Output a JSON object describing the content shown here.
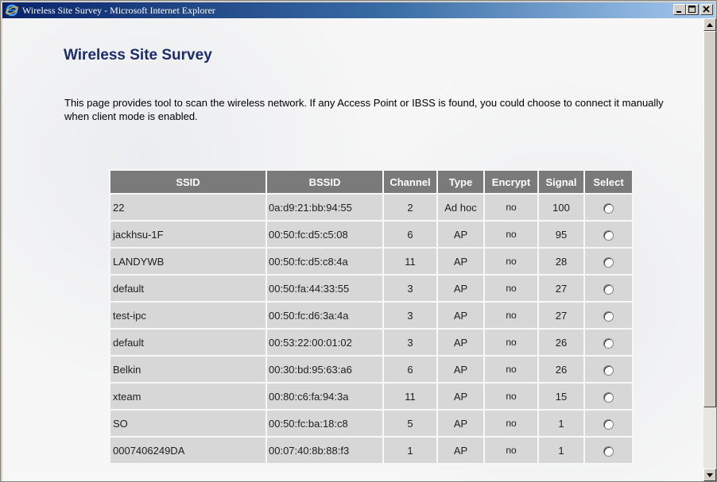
{
  "window": {
    "title": "Wireless Site Survey - Microsoft Internet Explorer",
    "minimize_glyph": "_",
    "maximize_glyph": "□",
    "close_glyph": "✕"
  },
  "page": {
    "title": "Wireless Site Survey",
    "description": "This page provides tool to scan the wireless network. If any Access Point or IBSS is found, you could choose to connect it manually when client mode is enabled."
  },
  "table": {
    "headers": {
      "ssid": "SSID",
      "bssid": "BSSID",
      "channel": "Channel",
      "type": "Type",
      "encrypt": "Encrypt",
      "signal": "Signal",
      "select": "Select"
    },
    "rows": [
      {
        "ssid": "22",
        "bssid": "0a:d9:21:bb:94:55",
        "channel": "2",
        "type": "Ad hoc",
        "encrypt": "no",
        "signal": "100"
      },
      {
        "ssid": "jackhsu-1F",
        "bssid": "00:50:fc:d5:c5:08",
        "channel": "6",
        "type": "AP",
        "encrypt": "no",
        "signal": "95"
      },
      {
        "ssid": "LANDYWB",
        "bssid": "00:50:fc:d5:c8:4a",
        "channel": "11",
        "type": "AP",
        "encrypt": "no",
        "signal": "28"
      },
      {
        "ssid": "default",
        "bssid": "00:50:fa:44:33:55",
        "channel": "3",
        "type": "AP",
        "encrypt": "no",
        "signal": "27"
      },
      {
        "ssid": "test-ipc",
        "bssid": "00:50:fc:d6:3a:4a",
        "channel": "3",
        "type": "AP",
        "encrypt": "no",
        "signal": "27"
      },
      {
        "ssid": "default",
        "bssid": "00:53:22:00:01:02",
        "channel": "3",
        "type": "AP",
        "encrypt": "no",
        "signal": "26"
      },
      {
        "ssid": "Belkin",
        "bssid": "00:30:bd:95:63:a6",
        "channel": "6",
        "type": "AP",
        "encrypt": "no",
        "signal": "26"
      },
      {
        "ssid": "xteam",
        "bssid": "00:80:c6:fa:94:3a",
        "channel": "11",
        "type": "AP",
        "encrypt": "no",
        "signal": "15"
      },
      {
        "ssid": "SO",
        "bssid": "00:50:fc:ba:18:c8",
        "channel": "5",
        "type": "AP",
        "encrypt": "no",
        "signal": "1"
      },
      {
        "ssid": "0007406249DA",
        "bssid": "00:07:40:8b:88:f3",
        "channel": "1",
        "type": "AP",
        "encrypt": "no",
        "signal": "1"
      }
    ]
  },
  "icons": {
    "app": "internet-explorer-icon",
    "scroll_up": "scroll-up-arrow-icon",
    "scroll_down": "scroll-down-arrow-icon"
  },
  "colors": {
    "title_text": "#1c2c6c",
    "header_bg": "#7a7a7a",
    "cell_bg": "#d7d7d7",
    "titlebar_start": "#0a246a",
    "titlebar_end": "#a6caf0"
  }
}
